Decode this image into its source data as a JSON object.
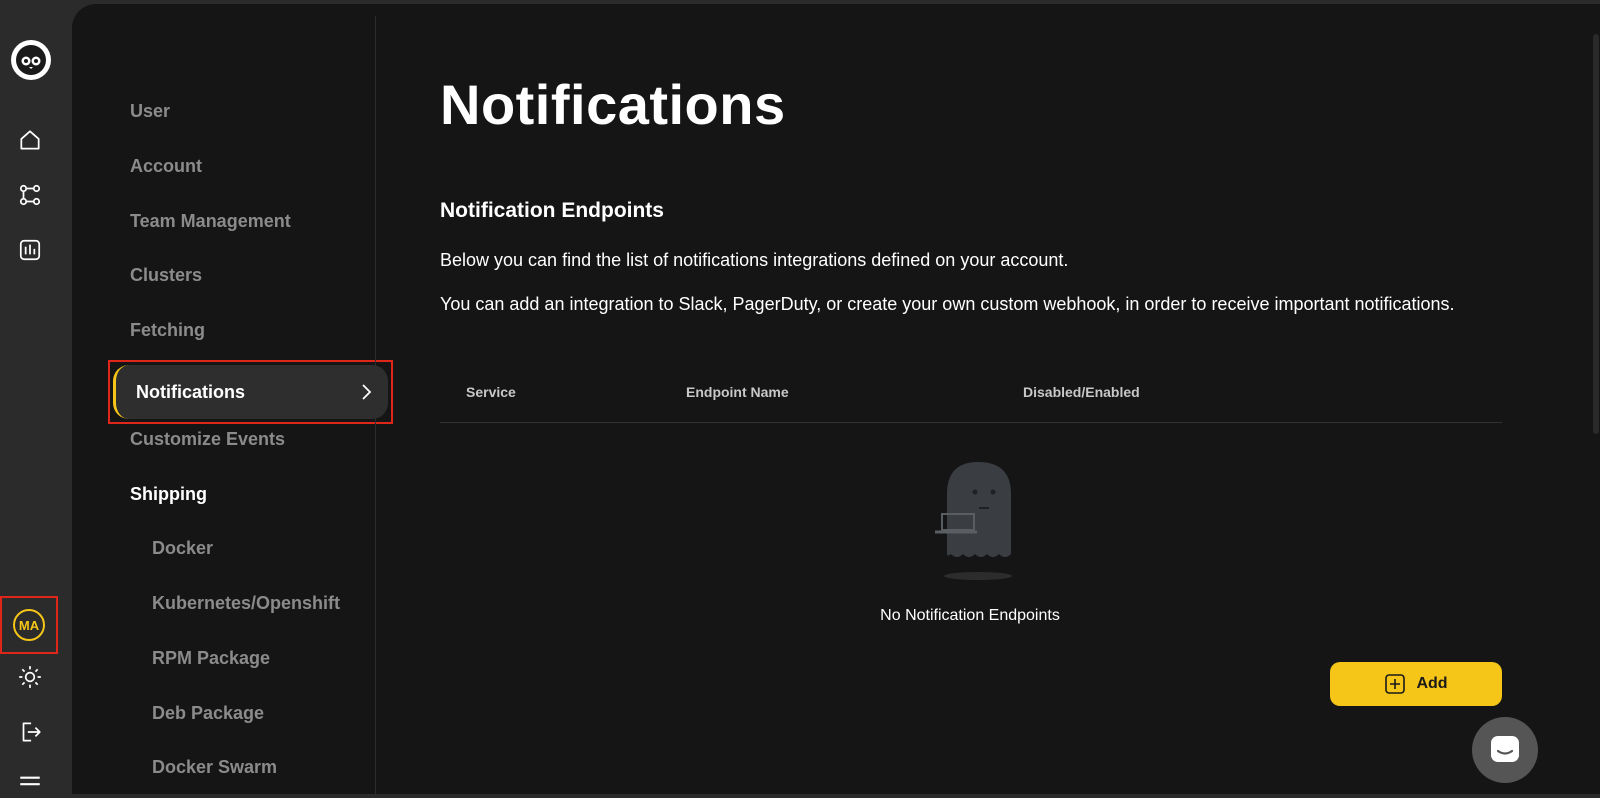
{
  "rail": {
    "avatar_initials": "MA"
  },
  "settings_nav": {
    "items": [
      {
        "label": "User"
      },
      {
        "label": "Account"
      },
      {
        "label": "Team Management"
      },
      {
        "label": "Clusters"
      },
      {
        "label": "Fetching"
      },
      {
        "label": "Notifications"
      },
      {
        "label": "Customize Events"
      },
      {
        "label": "Shipping"
      },
      {
        "label": "Docker"
      },
      {
        "label": "Kubernetes/Openshift"
      },
      {
        "label": "RPM Package"
      },
      {
        "label": "Deb Package"
      },
      {
        "label": "Docker Swarm"
      }
    ],
    "active": "Notifications"
  },
  "main": {
    "title": "Notifications",
    "section_title": "Notification Endpoints",
    "description_1": "Below you can find the list of notifications integrations defined on your account.",
    "description_2": "You can add an integration to Slack, PagerDuty, or create your own custom webhook, in order to receive important notifications.",
    "table": {
      "columns": [
        "Service",
        "Endpoint Name",
        "Disabled/Enabled"
      ],
      "rows": []
    },
    "empty_text": "No Notification Endpoints",
    "add_label": "Add"
  },
  "colors": {
    "accent": "#f5c518",
    "highlight_border": "#e0261b",
    "panel_bg": "#151515",
    "rail_bg": "#2b2b2b"
  }
}
